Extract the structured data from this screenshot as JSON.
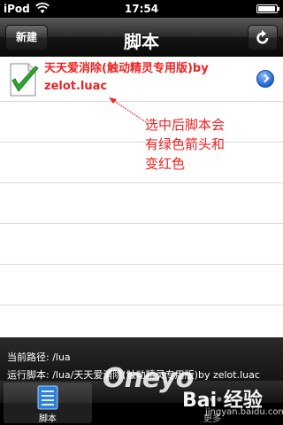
{
  "status_bar": {
    "carrier": "iPod",
    "time": "17:54"
  },
  "nav": {
    "title": "脚本",
    "new_button": "新建",
    "refresh_icon": "refresh-icon"
  },
  "script_list": {
    "items": [
      {
        "name": "天天爱消除(触动精灵专用版)by zelot.luac",
        "selected": true,
        "checkmark_color": "#2ea82e"
      }
    ],
    "text_color_selected": "#ee2222"
  },
  "annotation": {
    "text": "选中后脚本会有绿色箭头和变红色",
    "color": "#ee2222"
  },
  "info": {
    "current_path": "当前路径: /lua",
    "running_script": "运行脚本: /lua/天天爱消除(触动精灵专用版)by zelot.luac"
  },
  "tab_bar": {
    "tabs": [
      {
        "label": "脚本",
        "selected": true
      },
      {
        "label": "更多",
        "selected": false
      }
    ]
  },
  "watermarks": {
    "logo": "Oneyo",
    "brand": "Bai 经验",
    "url": "jingyan.baidu.com"
  }
}
